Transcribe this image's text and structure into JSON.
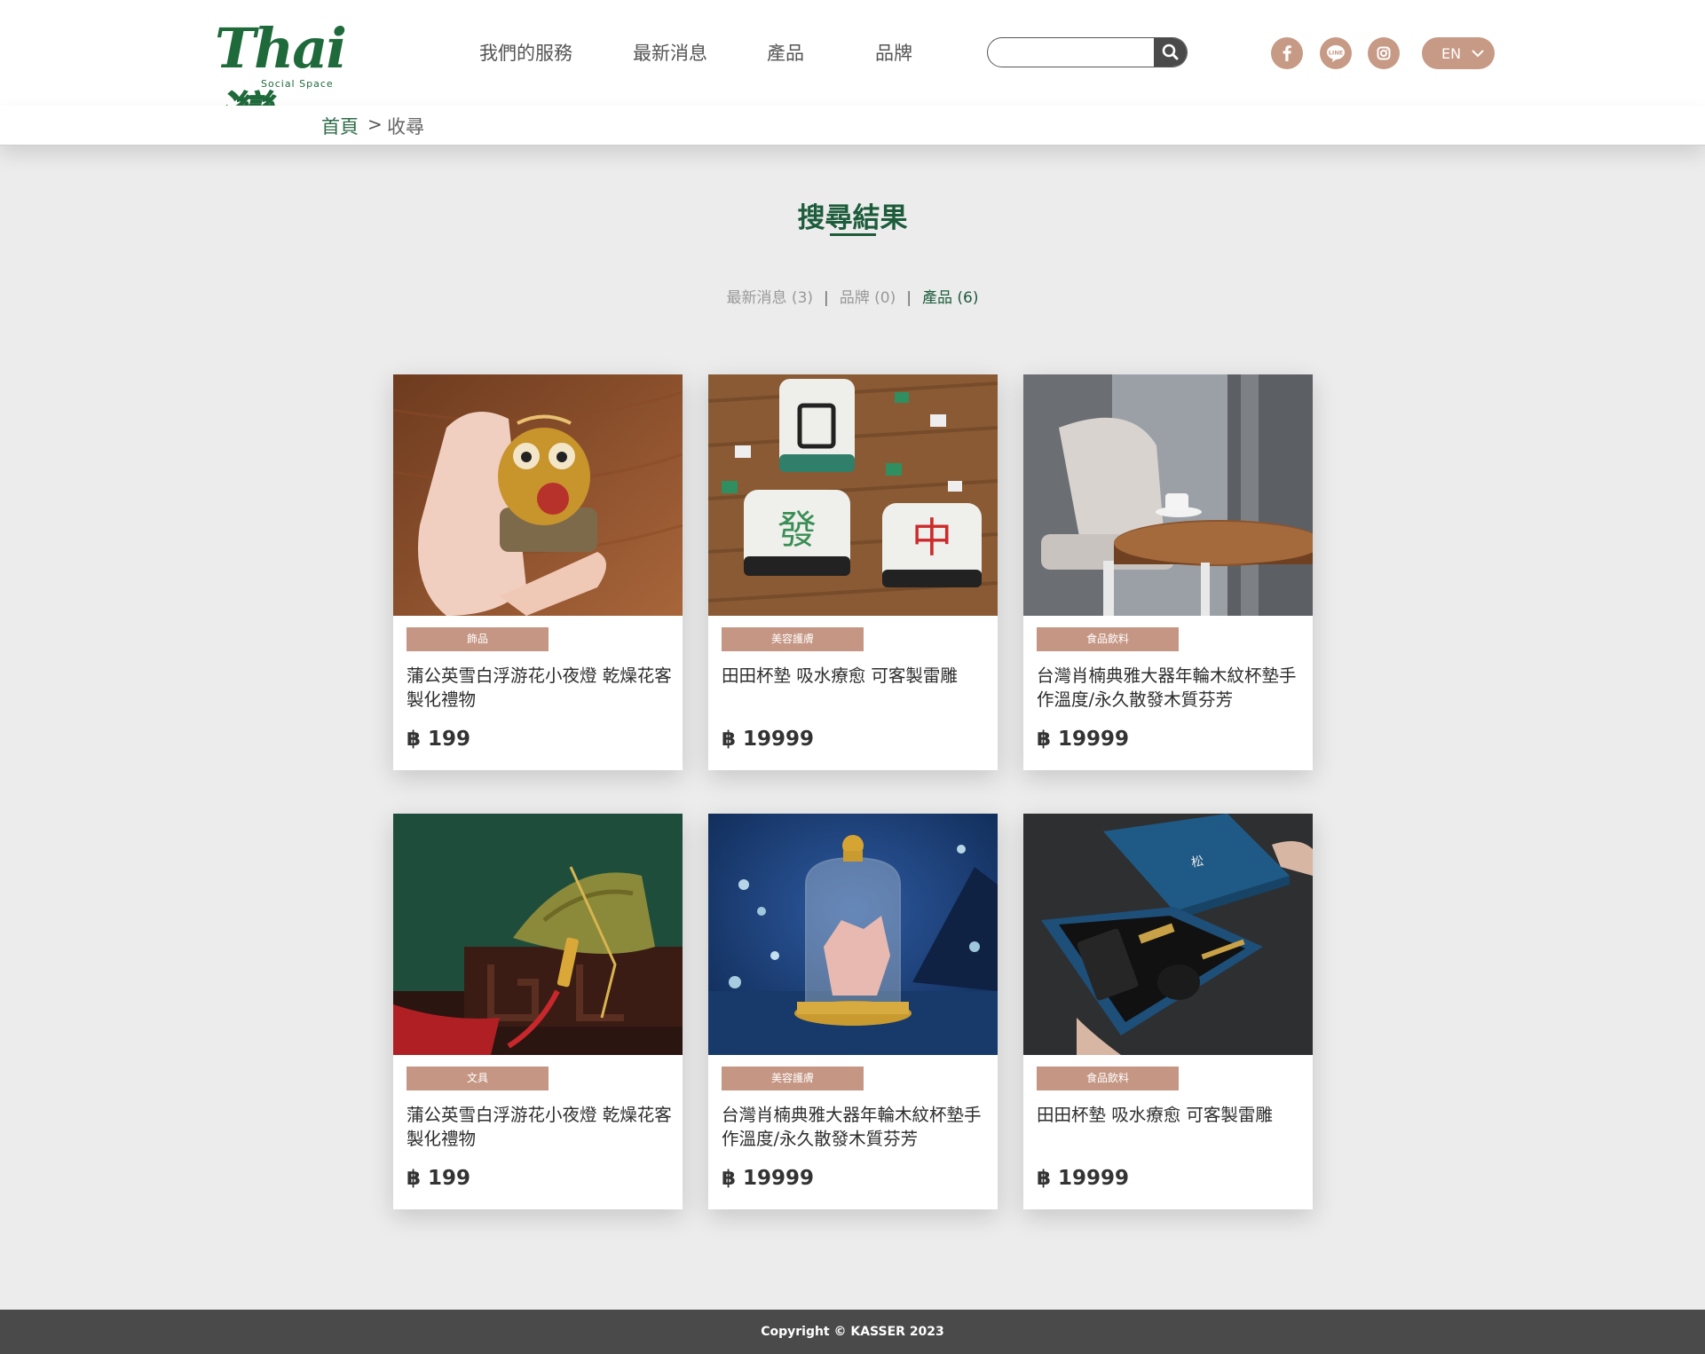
{
  "brand": {
    "logo_text": "Thai灣",
    "logo_subtext": "Social Space",
    "primary_color": "#1d5c3b",
    "accent_color": "#c59684"
  },
  "nav": {
    "items": [
      "我們的服務",
      "最新消息",
      "產品",
      "品牌"
    ]
  },
  "search": {
    "value": "",
    "placeholder": ""
  },
  "social": [
    {
      "name": "facebook-icon",
      "glyph": "f"
    },
    {
      "name": "line-icon",
      "glyph": "LINE"
    },
    {
      "name": "instagram-icon",
      "glyph": "◎"
    }
  ],
  "language": {
    "label": "EN"
  },
  "breadcrumb": {
    "home": "首頁",
    "separator": ">",
    "current": "收尋"
  },
  "page": {
    "title": "搜尋結果",
    "filters": [
      {
        "label": "最新消息 (3)",
        "active": false
      },
      {
        "label": "品牌 (0)",
        "active": false
      },
      {
        "label": "產品 (6)",
        "active": true
      }
    ]
  },
  "products": [
    {
      "category": "飾品",
      "name": "蒲公英雪白浮游花小夜燈 乾燥花客製化禮物",
      "price": "฿ 199",
      "image": "golden-owl-figurine"
    },
    {
      "category": "美容護膚",
      "name": "田田杯墊 吸水療愈 可客製雷雕",
      "price": "฿ 19999",
      "image": "mahjong-tiles"
    },
    {
      "category": "食品飲料",
      "name": "台灣肖楠典雅大器年輪木紋杯墊手作溫度/永久散發木質芬芳",
      "price": "฿ 19999",
      "image": "cafe-table-with-cup"
    },
    {
      "category": "文具",
      "name": "蒲公英雪白浮游花小夜燈 乾燥花客製化禮物",
      "price": "฿ 199",
      "image": "zongzi-ornament"
    },
    {
      "category": "美容護膚",
      "name": "台灣肖楠典雅大器年輪木紋杯墊手作溫度/永久散發木質芬芳",
      "price": "฿ 19999",
      "image": "glass-bell-jar"
    },
    {
      "category": "食品飲料",
      "name": "田田杯墊 吸水療愈 可客製雷雕",
      "price": "฿ 19999",
      "image": "gift-box-set"
    }
  ],
  "footer": {
    "copyright": "Copyright © KASSER 2023"
  }
}
